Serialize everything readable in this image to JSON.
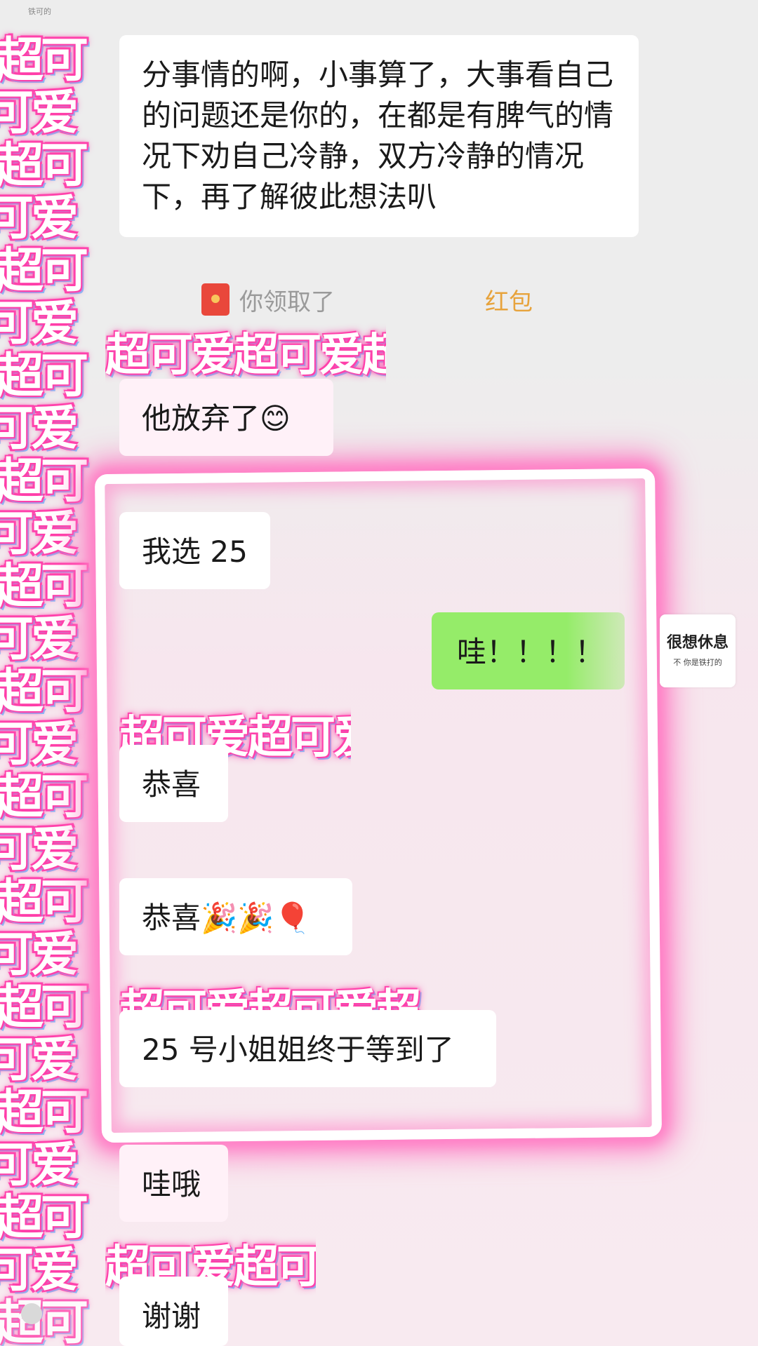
{
  "status_hint": "铁可的",
  "messages": [
    {
      "id": "m1",
      "side": "left",
      "text": "分事情的啊，小事算了，大事看自己的问题还是你的，在都是有脾气的情况下劝自己冷静，双方冷静的情况下，再了解彼此想法叭"
    },
    {
      "id": "m2",
      "side": "left",
      "text": "他放弃了😊"
    },
    {
      "id": "m3",
      "side": "left",
      "text": "我选 25"
    },
    {
      "id": "m4",
      "side": "right",
      "text": "哇！！！！"
    },
    {
      "id": "m5",
      "side": "left",
      "text": "恭喜"
    },
    {
      "id": "m6",
      "side": "left",
      "text": "恭喜🎉🎉🎈"
    },
    {
      "id": "m7",
      "side": "left",
      "text": "25 号小姐姐终于等到了"
    },
    {
      "id": "m8",
      "side": "left",
      "text": "哇哦"
    },
    {
      "id": "m9",
      "side": "left",
      "text": "谢谢"
    }
  ],
  "system": {
    "redpacket_prefix": "你领取了",
    "redpacket_link": "红包",
    "icon": "red-packet-icon"
  },
  "sticker_card": {
    "title": "很想休息",
    "caption": "不 你是铁打的"
  },
  "sticker_text": {
    "row_a": "超可",
    "row_b": "可爱",
    "band": "超可爱超可爱超"
  },
  "colors": {
    "sticker_pink": "#ff3da8",
    "sticker_blue": "#7cc8ff",
    "bubble_green": "#95ec69",
    "redpacket_red": "#e9473b"
  }
}
